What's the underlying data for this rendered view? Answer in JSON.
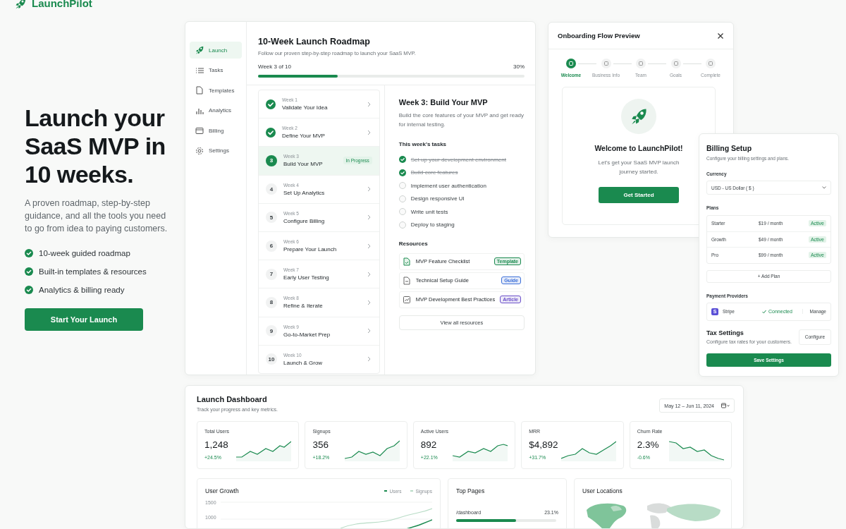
{
  "logo": {
    "name": "LaunchPilot"
  },
  "hero": {
    "title": "Launch your SaaS MVP in 10 weeks.",
    "subtitle": "A proven roadmap, step-by-step guidance, and all the tools you need to go from idea to paying customers.",
    "features": [
      "10-week guided roadmap",
      "Built-in templates & resources",
      "Analytics & billing ready"
    ],
    "cta": "Start Your Launch"
  },
  "roadmap": {
    "sidebar": [
      {
        "label": "Launch",
        "selected": true
      },
      {
        "label": "Tasks",
        "selected": false
      },
      {
        "label": "Templates",
        "selected": false
      },
      {
        "label": "Analytics",
        "selected": false
      },
      {
        "label": "Billing",
        "selected": false
      },
      {
        "label": "Settings",
        "selected": false
      }
    ],
    "title": "10-Week Launch Roadmap",
    "subtitle": "Follow our proven step-by-step roadmap to launch your SaaS MVP.",
    "progress_label": "Week 3 of 10",
    "progress_value": "30%",
    "level": 0.3,
    "weeks": [
      {
        "week": "Week 1",
        "title": "Validate Your Idea",
        "completed": true,
        "selected": false
      },
      {
        "week": "Week 2",
        "title": "Define Your MVP",
        "completed": true,
        "selected": false
      },
      {
        "week": "Week 3",
        "title": "Build Your MVP",
        "number": "3",
        "completed": false,
        "selected": true,
        "badge": "In Progress"
      },
      {
        "week": "Week 4",
        "title": "Set Up Analytics",
        "number": "4",
        "completed": false,
        "selected": false
      },
      {
        "week": "Week 5",
        "title": "Configure Billing",
        "number": "5",
        "completed": false,
        "selected": false
      },
      {
        "week": "Week 6",
        "title": "Prepare Your Launch",
        "number": "6",
        "completed": false,
        "selected": false
      },
      {
        "week": "Week 7",
        "title": "Early User Testing",
        "number": "7",
        "completed": false,
        "selected": false
      },
      {
        "week": "Week 8",
        "title": "Refine & Iterate",
        "number": "8",
        "completed": false,
        "selected": false
      },
      {
        "week": "Week 9",
        "title": "Go-to-Market Prep",
        "number": "9",
        "completed": false,
        "selected": false
      },
      {
        "week": "Week 10",
        "title": "Launch & Grow",
        "number": "10",
        "completed": false,
        "selected": false
      }
    ],
    "detail": {
      "title": "Week 3: Build Your MVP",
      "description": "Build the core features of your MVP and get ready for internal testing.",
      "tasks_heading": "This week's tasks",
      "tasks": [
        {
          "label": "Set up your development environment",
          "checked": true
        },
        {
          "label": "Build core features",
          "checked": true
        },
        {
          "label": "Implement user authentication",
          "checked": false
        },
        {
          "label": "Design responsive UI",
          "checked": false
        },
        {
          "label": "Write unit tests",
          "checked": false
        },
        {
          "label": "Deploy to staging",
          "checked": false
        }
      ],
      "resources_heading": "Resources",
      "resources": [
        {
          "title": "MVP Feature Checklist",
          "tag": "Template",
          "color": "#1a8a4f"
        },
        {
          "title": "Technical Setup Guide",
          "tag": "Guide",
          "color": "#3b6fd8"
        },
        {
          "title": "MVP Development Best Practices",
          "tag": "Article",
          "color": "#6a4fc9"
        }
      ],
      "view_all": "View all resources"
    }
  },
  "onboarding": {
    "title": "Onboarding Flow Preview",
    "steps": [
      {
        "label": "Welcome",
        "selected": true
      },
      {
        "label": "Business Info",
        "selected": false
      },
      {
        "label": "Team",
        "selected": false
      },
      {
        "label": "Goals",
        "selected": false
      },
      {
        "label": "Complete",
        "selected": false
      }
    ],
    "welcome_title": "Welcome to LaunchPilot!",
    "welcome_text": "Let's get your SaaS MVP launch journey started.",
    "button": "Get Started"
  },
  "billing": {
    "title": "Billing Setup",
    "subtitle": "Configure your billing settings and plans.",
    "currency_label": "Currency",
    "currency": "USD - US Dollar ( $ )",
    "plans_label": "Plans",
    "plans": [
      {
        "name": "Starter",
        "price": "$19 / month",
        "status": "Active"
      },
      {
        "name": "Growth",
        "price": "$49 / month",
        "status": "Active"
      },
      {
        "name": "Pro",
        "price": "$99 / month",
        "status": "Active"
      }
    ],
    "add_plan": "+ Add Plan",
    "providers_label": "Payment Providers",
    "provider": {
      "logo": "S",
      "name": "Stripe",
      "status": "Connected",
      "action": "Manage"
    },
    "tax_title": "Tax Settings",
    "tax_subtitle": "Configure tax rates for your customers.",
    "tax_button": "Configure",
    "save": "Save Settings"
  },
  "dashboard": {
    "title": "Launch Dashboard",
    "subtitle": "Track your progress and key metrics.",
    "date_range": "May 12 – Jun 11, 2024",
    "metrics": [
      {
        "label": "Total Users",
        "value": "1,248",
        "change": "+24.5%",
        "rising": true
      },
      {
        "label": "Signups",
        "value": "356",
        "change": "+18.2%",
        "rising": true
      },
      {
        "label": "Active Users",
        "value": "892",
        "change": "+22.1%",
        "rising": true
      },
      {
        "label": "MRR",
        "value": "$4,892",
        "change": "+31.7%",
        "rising": true
      },
      {
        "label": "Churn Rate",
        "value": "2.3%",
        "change": "-0.6%",
        "rising": false
      }
    ],
    "user_growth": {
      "title": "User Growth",
      "legend": [
        "Users",
        "Signups"
      ],
      "y_labels": [
        "1500",
        "1000"
      ]
    },
    "top_pages": {
      "title": "Top Pages",
      "rows": [
        {
          "path": "/dashboard",
          "share": "23.1%",
          "level": 0.6
        }
      ]
    },
    "user_locations": {
      "title": "User Locations"
    }
  }
}
